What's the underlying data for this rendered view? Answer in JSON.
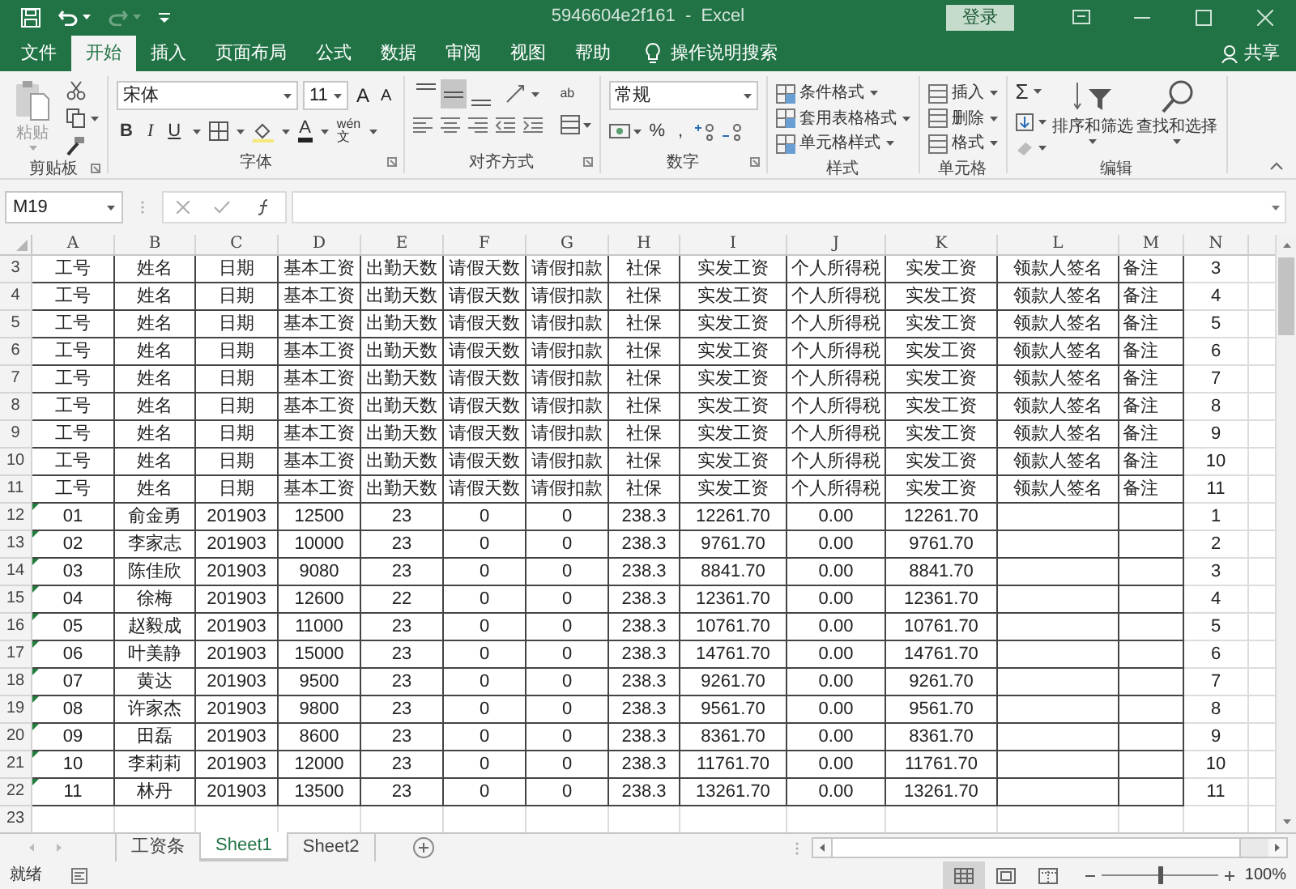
{
  "title_bar": {
    "title": "5946604e2f161  -  Excel",
    "sign_in": "登录",
    "redo_enabled": false
  },
  "ribbon_tabs": [
    {
      "label": "文件",
      "selected": false
    },
    {
      "label": "开始",
      "selected": true
    },
    {
      "label": "插入",
      "selected": false
    },
    {
      "label": "页面布局",
      "selected": false
    },
    {
      "label": "公式",
      "selected": false
    },
    {
      "label": "数据",
      "selected": false
    },
    {
      "label": "审阅",
      "selected": false
    },
    {
      "label": "视图",
      "selected": false
    },
    {
      "label": "帮助",
      "selected": false
    }
  ],
  "tell_me": "操作说明搜索",
  "share": "共享",
  "ribbon": {
    "clipboard": {
      "paste": "粘贴",
      "paste_disabled": true,
      "label": "剪贴板"
    },
    "font": {
      "font_name": "宋体",
      "font_size": "11",
      "grow": "A",
      "shrink": "A",
      "styles": [
        "B",
        "I",
        "U"
      ],
      "font_color_letter": "A",
      "phonetic": "文",
      "phonetic_reading": "wén",
      "label": "字体"
    },
    "alignment": {
      "vertical": [
        {
          "selected": false
        },
        {
          "selected": true
        },
        {
          "selected": false
        }
      ],
      "wrap_glyph": "ab",
      "label": "对齐方式"
    },
    "number": {
      "format": "常规",
      "symbols": [
        "%",
        ","
      ],
      "label": "数字"
    },
    "styles": {
      "items": [
        "条件格式",
        "套用表格格式",
        "单元格样式"
      ],
      "label": "样式"
    },
    "cells": {
      "items": [
        "插入",
        "删除",
        "格式"
      ],
      "label": "单元格"
    },
    "editing": {
      "autosum": "Σ",
      "sort": "排序和筛选",
      "find": "查找和选择",
      "label": "编辑"
    }
  },
  "name_box": "M19",
  "columns": [
    "A",
    "B",
    "C",
    "D",
    "E",
    "F",
    "G",
    "H",
    "I",
    "J",
    "K",
    "L",
    "M",
    "N"
  ],
  "rows": [
    {
      "number": "3",
      "flagged": false,
      "cells": [
        "工号",
        "姓名",
        "日期",
        "基本工资",
        "出勤天数",
        "请假天数",
        "请假扣款",
        "社保",
        "实发工资",
        "个人所得税",
        "实发工资",
        "领款人签名",
        "备注",
        "3"
      ]
    },
    {
      "number": "4",
      "flagged": false,
      "cells": [
        "工号",
        "姓名",
        "日期",
        "基本工资",
        "出勤天数",
        "请假天数",
        "请假扣款",
        "社保",
        "实发工资",
        "个人所得税",
        "实发工资",
        "领款人签名",
        "备注",
        "4"
      ]
    },
    {
      "number": "5",
      "flagged": false,
      "cells": [
        "工号",
        "姓名",
        "日期",
        "基本工资",
        "出勤天数",
        "请假天数",
        "请假扣款",
        "社保",
        "实发工资",
        "个人所得税",
        "实发工资",
        "领款人签名",
        "备注",
        "5"
      ]
    },
    {
      "number": "6",
      "flagged": false,
      "cells": [
        "工号",
        "姓名",
        "日期",
        "基本工资",
        "出勤天数",
        "请假天数",
        "请假扣款",
        "社保",
        "实发工资",
        "个人所得税",
        "实发工资",
        "领款人签名",
        "备注",
        "6"
      ]
    },
    {
      "number": "7",
      "flagged": false,
      "cells": [
        "工号",
        "姓名",
        "日期",
        "基本工资",
        "出勤天数",
        "请假天数",
        "请假扣款",
        "社保",
        "实发工资",
        "个人所得税",
        "实发工资",
        "领款人签名",
        "备注",
        "7"
      ]
    },
    {
      "number": "8",
      "flagged": false,
      "cells": [
        "工号",
        "姓名",
        "日期",
        "基本工资",
        "出勤天数",
        "请假天数",
        "请假扣款",
        "社保",
        "实发工资",
        "个人所得税",
        "实发工资",
        "领款人签名",
        "备注",
        "8"
      ]
    },
    {
      "number": "9",
      "flagged": false,
      "cells": [
        "工号",
        "姓名",
        "日期",
        "基本工资",
        "出勤天数",
        "请假天数",
        "请假扣款",
        "社保",
        "实发工资",
        "个人所得税",
        "实发工资",
        "领款人签名",
        "备注",
        "9"
      ]
    },
    {
      "number": "10",
      "flagged": false,
      "cells": [
        "工号",
        "姓名",
        "日期",
        "基本工资",
        "出勤天数",
        "请假天数",
        "请假扣款",
        "社保",
        "实发工资",
        "个人所得税",
        "实发工资",
        "领款人签名",
        "备注",
        "10"
      ]
    },
    {
      "number": "11",
      "flagged": false,
      "cells": [
        "工号",
        "姓名",
        "日期",
        "基本工资",
        "出勤天数",
        "请假天数",
        "请假扣款",
        "社保",
        "实发工资",
        "个人所得税",
        "实发工资",
        "领款人签名",
        "备注",
        "11"
      ]
    },
    {
      "number": "12",
      "flagged": true,
      "cells": [
        "01",
        "俞金勇",
        "201903",
        "12500",
        "23",
        "0",
        "0",
        "238.3",
        "12261.70",
        "0.00",
        "12261.70",
        null,
        null,
        "1"
      ]
    },
    {
      "number": "13",
      "flagged": true,
      "cells": [
        "02",
        "李家志",
        "201903",
        "10000",
        "23",
        "0",
        "0",
        "238.3",
        "9761.70",
        "0.00",
        "9761.70",
        null,
        null,
        "2"
      ]
    },
    {
      "number": "14",
      "flagged": true,
      "cells": [
        "03",
        "陈佳欣",
        "201903",
        "9080",
        "23",
        "0",
        "0",
        "238.3",
        "8841.70",
        "0.00",
        "8841.70",
        null,
        null,
        "3"
      ]
    },
    {
      "number": "15",
      "flagged": true,
      "cells": [
        "04",
        "徐梅",
        "201903",
        "12600",
        "22",
        "0",
        "0",
        "238.3",
        "12361.70",
        "0.00",
        "12361.70",
        null,
        null,
        "4"
      ]
    },
    {
      "number": "16",
      "flagged": true,
      "cells": [
        "05",
        "赵毅成",
        "201903",
        "11000",
        "23",
        "0",
        "0",
        "238.3",
        "10761.70",
        "0.00",
        "10761.70",
        null,
        null,
        "5"
      ]
    },
    {
      "number": "17",
      "flagged": true,
      "cells": [
        "06",
        "叶美静",
        "201903",
        "15000",
        "23",
        "0",
        "0",
        "238.3",
        "14761.70",
        "0.00",
        "14761.70",
        null,
        null,
        "6"
      ]
    },
    {
      "number": "18",
      "flagged": true,
      "cells": [
        "07",
        "黄达",
        "201903",
        "9500",
        "23",
        "0",
        "0",
        "238.3",
        "9261.70",
        "0.00",
        "9261.70",
        null,
        null,
        "7"
      ]
    },
    {
      "number": "19",
      "flagged": true,
      "cells": [
        "08",
        "许家杰",
        "201903",
        "9800",
        "23",
        "0",
        "0",
        "238.3",
        "9561.70",
        "0.00",
        "9561.70",
        null,
        null,
        "8"
      ]
    },
    {
      "number": "20",
      "flagged": true,
      "cells": [
        "09",
        "田磊",
        "201903",
        "8600",
        "23",
        "0",
        "0",
        "238.3",
        "8361.70",
        "0.00",
        "8361.70",
        null,
        null,
        "9"
      ]
    },
    {
      "number": "21",
      "flagged": true,
      "cells": [
        "10",
        "李莉莉",
        "201903",
        "12000",
        "23",
        "0",
        "0",
        "238.3",
        "11761.70",
        "0.00",
        "11761.70",
        null,
        null,
        "10"
      ]
    },
    {
      "number": "22",
      "flagged": true,
      "cells": [
        "11",
        "林丹",
        "201903",
        "13500",
        "23",
        "0",
        "0",
        "238.3",
        "13261.70",
        "0.00",
        "13261.70",
        null,
        null,
        "11"
      ]
    },
    {
      "number": "23",
      "flagged": false
    }
  ],
  "sheet_tabs": [
    {
      "label": "工资条",
      "selected": false
    },
    {
      "label": "Sheet1",
      "selected": true
    },
    {
      "label": "Sheet2",
      "selected": false
    }
  ],
  "status": "就绪",
  "views": [
    {
      "selected": true
    },
    {
      "selected": false
    },
    {
      "selected": false
    }
  ],
  "zoom": {
    "level": 0.5,
    "reading": "100%"
  }
}
